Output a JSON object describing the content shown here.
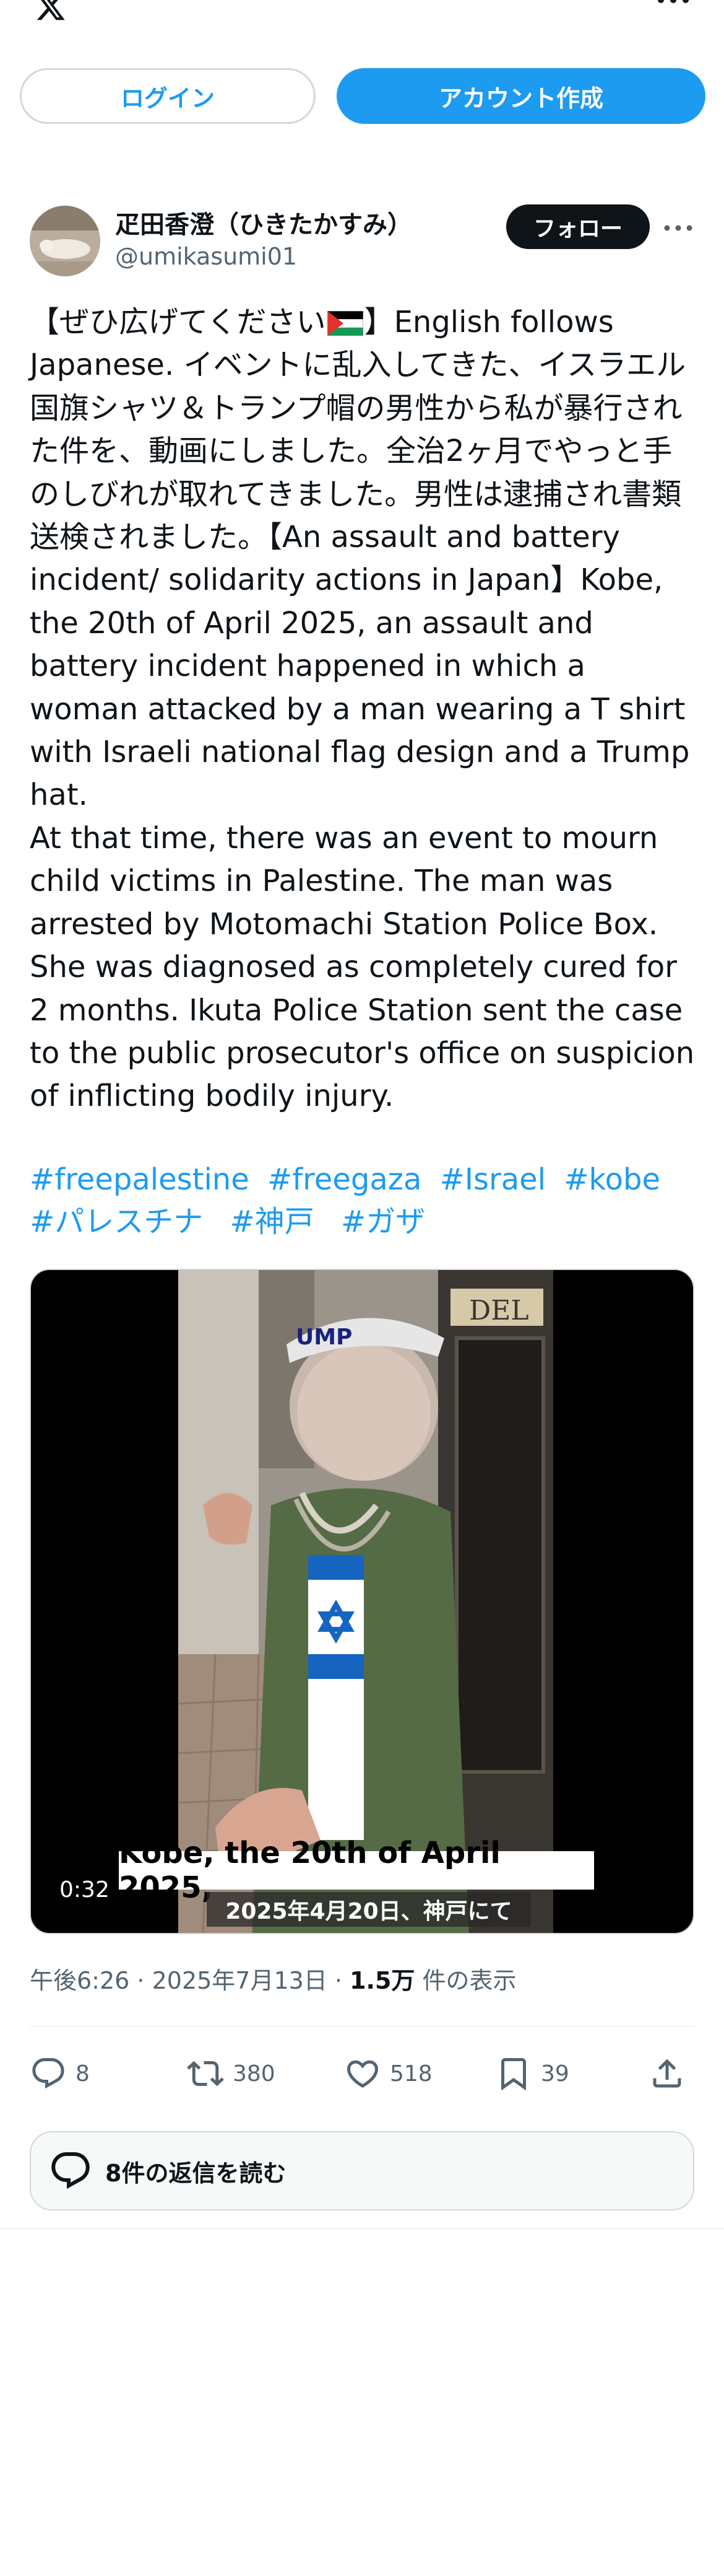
{
  "auth": {
    "login_label": "ログイン",
    "signup_label": "アカウント作成"
  },
  "author": {
    "display_name": "疋田香澄（ひきたかすみ）",
    "handle": "@umikasumi01",
    "follow_label": "フォロー"
  },
  "tweet": {
    "text_before_flag": "【ぜひ広げてください",
    "text_after_flag": "】English follows Japanese. イベントに乱入してきた、イスラエル国旗シャツ＆トランプ帽の男性から私が暴行された件を、動画にしました。全治2ヶ月でやっと手のしびれが取れてきました。男性は逮捕され書類送検されました。【An assault and battery incident/ solidarity actions in Japan】Kobe, the 20th of April 2025, an assault and battery incident happened in which a woman attacked by a man wearing a T shirt with Israeli national flag design and a Trump hat.\nAt that time, there was an event to mourn child victims in Palestine. The man was arrested by Motomachi Station Police Box. She was diagnosed as completely cured for 2 months. Ikuta Police Station sent the case to the public prosecutor's office on suspicion of inflicting bodily injury.",
    "hashtags": [
      "#freepalestine",
      "#freegaza",
      "#Israel",
      "#kobe",
      "#パレスチナ",
      "#神戸",
      "#ガザ"
    ]
  },
  "media": {
    "duration": "0:32",
    "subtitle_en": "Kobe, the 20th of April 2025,",
    "subtitle_jp": "2025年4月20日、神戸にて",
    "sign_text": "DEL",
    "cap_text": "UMP"
  },
  "meta": {
    "time": "午後6:26",
    "date": "2025年7月13日",
    "views_count": "1.5万",
    "views_label": "件の表示"
  },
  "actions": {
    "replies": "8",
    "reposts": "380",
    "likes": "518",
    "bookmarks": "39"
  },
  "read_replies_label": "8件の返信を読む",
  "colors": {
    "accent": "#1d9bf0",
    "text": "#0f1419",
    "muted": "#536471",
    "border": "#cfd9de"
  }
}
